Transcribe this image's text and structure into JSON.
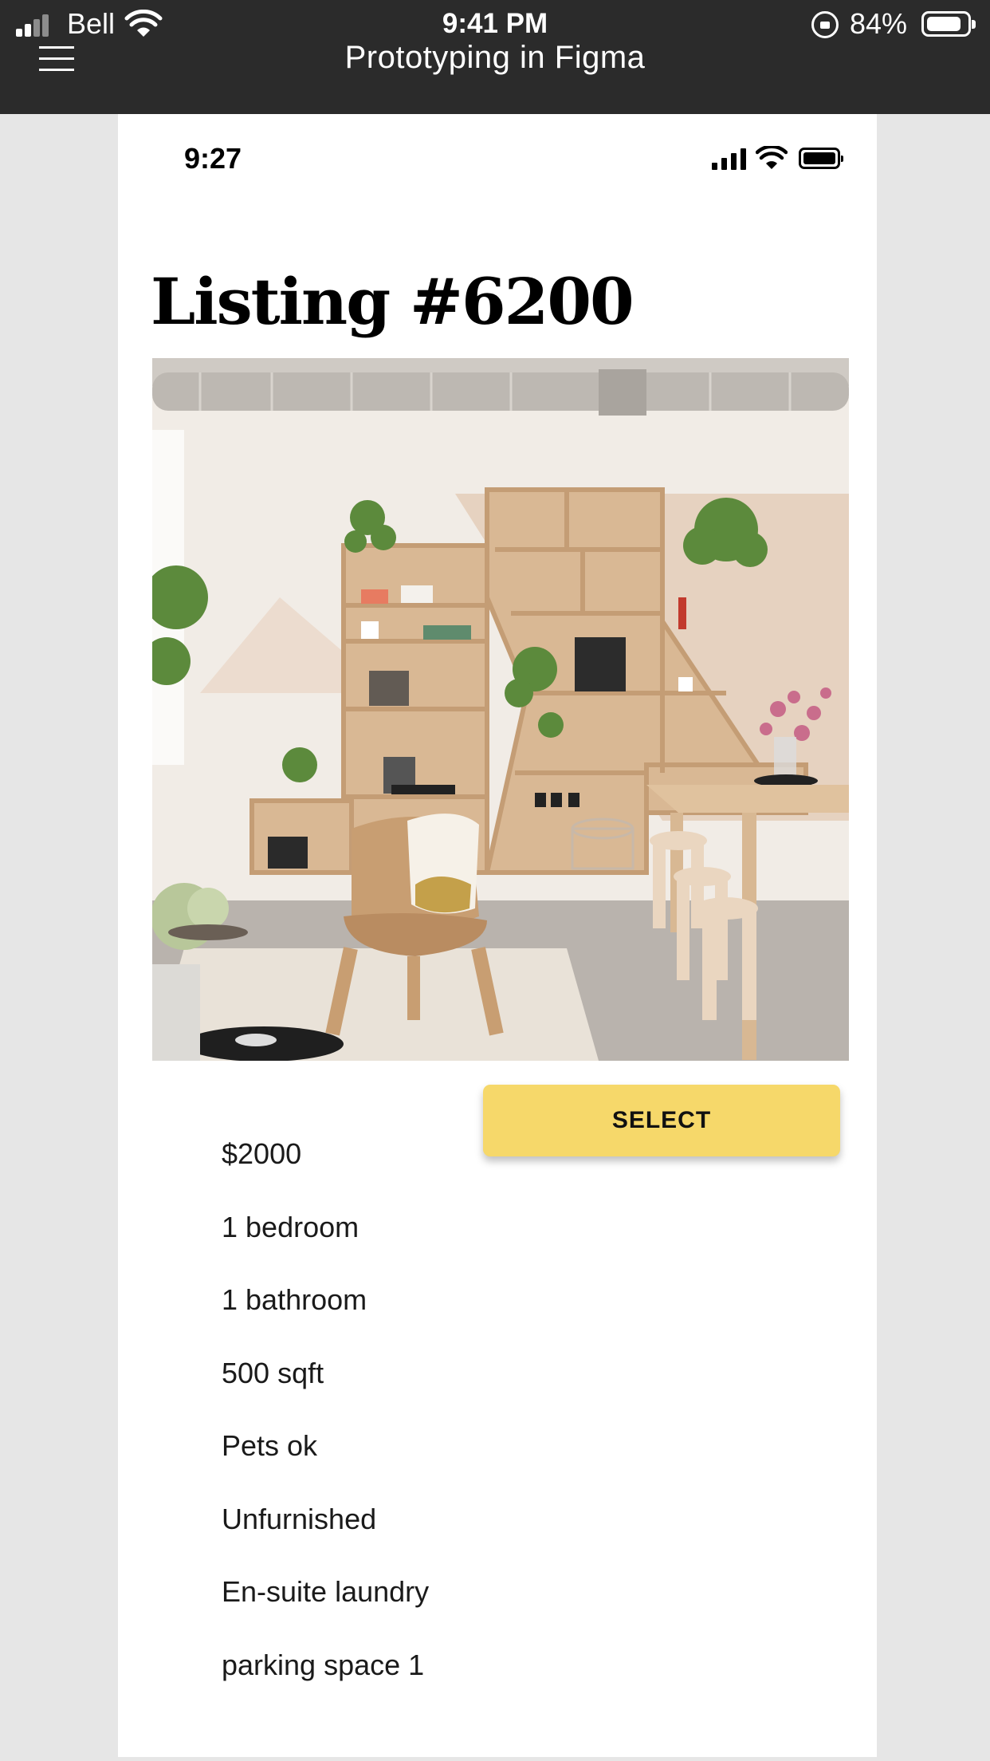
{
  "host_status": {
    "carrier": "Bell",
    "time": "9:41 PM",
    "battery_percent": "84%",
    "battery_level": 0.84
  },
  "app_bar": {
    "title": "Prototyping in Figma",
    "menu_icon": "hamburger-menu-icon"
  },
  "prototype": {
    "status_bar": {
      "time": "9:27"
    },
    "title": "Listing #6200",
    "photo": "interior-living-room-shelves-photo",
    "select_label": "SELECT",
    "details": [
      "$2000",
      "1 bedroom",
      "1 bathroom",
      "500 sqft",
      "Pets ok",
      "Unfurnished",
      "En-suite laundry",
      "parking space 1"
    ]
  },
  "colors": {
    "app_bar_bg": "#2b2b2b",
    "page_bg": "#e6e6e6",
    "accent_button": "#f6d86a"
  }
}
